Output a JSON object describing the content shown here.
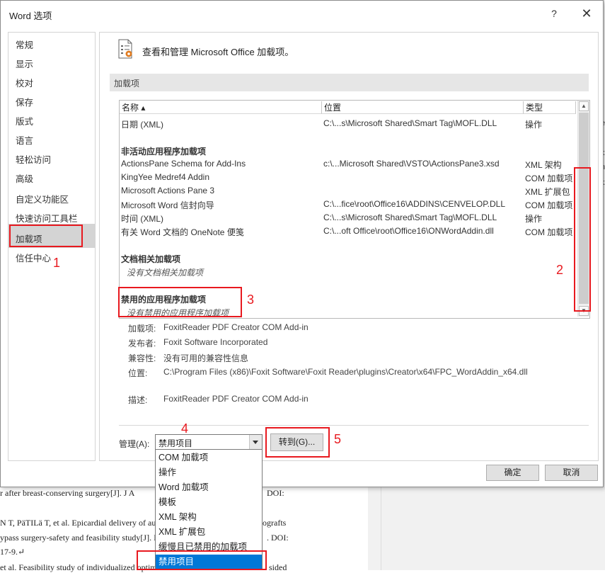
{
  "background_doc": {
    "lines": [
      "r after breast-conserving surgery[J]. J A",
      "N T, PäTILä T, et al. Epicardial delivery of au",
      "ypass surgery-safety and feasibility study[J]. I",
      "17-9.↵",
      "et al. Feasibility study of individualized optim"
    ],
    "line_tails": [
      "DOI:",
      "ografts",
      ". DOI:",
      "",
      "sided"
    ],
    "right_chars": [
      "e",
      "x",
      "n",
      "k"
    ]
  },
  "dialog": {
    "title": "Word 选项",
    "help": "?",
    "close": "✕"
  },
  "nav": {
    "items": [
      "常规",
      "显示",
      "校对",
      "保存",
      "版式",
      "语言",
      "轻松访问",
      "高级",
      "自定义功能区",
      "快速访问工具栏",
      "加载项",
      "信任中心"
    ],
    "selected": "加载项"
  },
  "header": {
    "text": "查看和管理 Microsoft Office 加载项。"
  },
  "section_title": "加载项",
  "columns": {
    "name": "名称 ▴",
    "location": "位置",
    "type": "类型"
  },
  "active_rows": [
    {
      "name": "日期 (XML)",
      "location": "C:\\...s\\Microsoft Shared\\Smart Tag\\MOFL.DLL",
      "type": "操作"
    }
  ],
  "inactive_group": "非活动应用程序加载项",
  "inactive_rows": [
    {
      "name": "ActionsPane Schema for Add-Ins",
      "location": "c:\\...Microsoft Shared\\VSTO\\ActionsPane3.xsd",
      "type": "XML 架构"
    },
    {
      "name": "KingYee Medref4 Addin",
      "location": "",
      "type": "COM 加载项"
    },
    {
      "name": "Microsoft Actions Pane 3",
      "location": "",
      "type": "XML 扩展包"
    },
    {
      "name": "Microsoft Word 信封向导",
      "location": "C:\\...fice\\root\\Office16\\ADDINS\\CENVELOP.DLL",
      "type": "COM 加载项"
    },
    {
      "name": "时间 (XML)",
      "location": "C:\\...s\\Microsoft Shared\\Smart Tag\\MOFL.DLL",
      "type": "操作"
    },
    {
      "name": "有关 Word 文档的 OneNote 便笺",
      "location": "C:\\...oft Office\\root\\Office16\\ONWordAddin.dll",
      "type": "COM 加载项"
    }
  ],
  "doc_group": "文档相关加载项",
  "doc_empty": "没有文档相关加载项",
  "disabled_group": "禁用的应用程序加载项",
  "disabled_empty": "没有禁用的应用程序加载项",
  "details": {
    "addin_label": "加载项:",
    "addin": "FoxitReader PDF Creator COM Add-in",
    "publisher_label": "发布者:",
    "publisher": "Foxit Software Incorporated",
    "compat_label": "兼容性:",
    "compat": "没有可用的兼容性信息",
    "location_label": "位置:",
    "location": "C:\\Program Files (x86)\\Foxit Software\\Foxit Reader\\plugins\\Creator\\x64\\FPC_WordAddin_x64.dll",
    "desc_label": "描述:",
    "desc": "FoxitReader PDF Creator COM Add-in"
  },
  "manage": {
    "label": "管理(A):",
    "selected": "禁用项目",
    "goto": "转到(G)...",
    "options": [
      "COM 加载项",
      "操作",
      "Word 加载项",
      "模板",
      "XML 架构",
      "XML 扩展包",
      "缓慢且已禁用的加载项",
      "禁用项目"
    ]
  },
  "buttons": {
    "ok": "确定",
    "cancel": "取消"
  },
  "annotations": [
    "1",
    "2",
    "3",
    "4",
    "5"
  ],
  "colors": {
    "annotation": "#e8191f",
    "selection": "#0078d7",
    "nav_selected": "#d4d4d4"
  }
}
